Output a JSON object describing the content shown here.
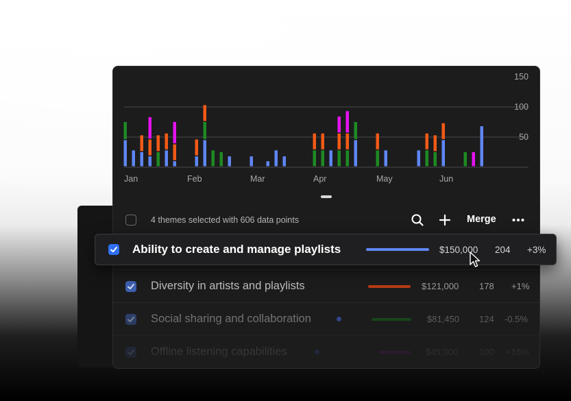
{
  "chart_data": {
    "type": "bar",
    "stacked": true,
    "y_ticks": [
      "150",
      "100",
      "50"
    ],
    "ylim": [
      0,
      150
    ],
    "grid": true,
    "months": [
      "Jan",
      "Feb",
      "Mar",
      "Apr",
      "May",
      "Jun"
    ],
    "series_colors": [
      "#5f86f4",
      "#1e8a23",
      "#f25a16",
      "#e412f0"
    ],
    "stacks": [
      [
        45,
        30,
        0,
        0
      ],
      [
        28,
        0,
        0,
        0
      ],
      [
        25,
        0,
        28,
        0
      ],
      [
        18,
        0,
        28,
        37
      ],
      [
        0,
        25,
        28,
        0
      ],
      [
        28,
        0,
        28,
        0
      ],
      [
        10,
        0,
        28,
        37
      ],
      [
        18,
        0,
        28,
        0
      ],
      [
        45,
        30,
        28,
        0
      ],
      [
        0,
        28,
        0,
        0
      ],
      [
        0,
        25,
        0,
        0
      ],
      [
        18,
        0,
        0,
        0
      ],
      [
        18,
        0,
        0,
        0
      ],
      [
        10,
        0,
        0,
        0
      ],
      [
        28,
        0,
        0,
        0
      ],
      [
        18,
        0,
        0,
        0
      ],
      [
        0,
        28,
        28,
        0
      ],
      [
        0,
        28,
        28,
        0
      ],
      [
        28,
        0,
        0,
        0
      ],
      [
        0,
        28,
        28,
        28
      ],
      [
        0,
        28,
        28,
        37
      ],
      [
        45,
        30,
        0,
        0
      ],
      [
        0,
        28,
        28,
        0
      ],
      [
        28,
        0,
        0,
        0
      ],
      [
        28,
        0,
        0,
        0
      ],
      [
        0,
        28,
        28,
        0
      ],
      [
        0,
        25,
        28,
        0
      ],
      [
        45,
        0,
        28,
        0
      ],
      [
        0,
        25,
        0,
        0
      ],
      [
        0,
        0,
        0,
        25
      ],
      [
        68,
        0,
        0,
        0
      ]
    ]
  },
  "toolbar": {
    "selection_text": "4 themes selected with 606 data points",
    "merge_label": "Merge"
  },
  "rows": [
    {
      "label": "Ability to create and manage playlists",
      "color": "#5f86f4",
      "amount": "$150,000",
      "count": "204",
      "change": "+3%"
    },
    {
      "label": "Diversity in artists and playlists",
      "color": "#f25a16",
      "amount": "$121,000",
      "count": "178",
      "change": "+1%"
    },
    {
      "label": "Social sharing and collaboration",
      "color": "#1e8a23",
      "amount": "$81,450",
      "count": "124",
      "change": "-0.5%"
    },
    {
      "label": "Offline listening capabilities",
      "color": "#e412f0",
      "amount": "$45,000",
      "count": "100",
      "change": "+16%"
    }
  ]
}
